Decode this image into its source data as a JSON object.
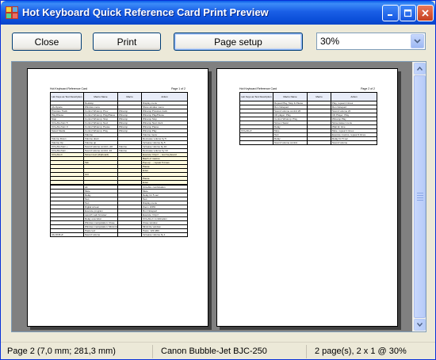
{
  "window": {
    "title": "Hot Keyboard Quick Reference Card Print Preview"
  },
  "toolbar": {
    "close_label": "Close",
    "print_label": "Print",
    "page_setup_label": "Page setup",
    "zoom_value": "30%"
  },
  "pages": [
    {
      "header_left": "Hot Keyboard Reference Card",
      "header_right": "Page 1 of 2",
      "columns": [
        "Hot Keys as Text Description",
        "Macro Name",
        "Macro",
        "Action"
      ],
      "rows": [
        [
          "",
          "Desktop",
          "",
          "Display menu"
        ],
        [
          "Alt+Space",
          "Window menu",
          "",
          "Show window menu"
        ],
        [
          "Previous Track",
          "Control Winamp: Prev",
          "Winamp",
          "Winamp Previous track"
        ],
        [
          "Play/Pause",
          "Control Winamp: Play/Pause",
          "Winamp",
          "Winamp Play/Pause"
        ],
        [
          "Stop",
          "Control Winamp: Stop",
          "Winamp",
          "Winamp Stop"
        ],
        [
          "Ctrl+Alt+Num 5",
          "Control Winamp: Next",
          "Winamp",
          "Winamp Next track"
        ],
        [
          "Ctrl+Alt+Num 0",
          "Control Winamp: Pause",
          "Winamp",
          "Winamp Pause"
        ],
        [
          "Select Media",
          "Control Winamp: Play",
          "Winamp",
          "Winamp Play"
        ],
        [
          "",
          "Volume",
          "",
          "Volume menu"
        ],
        [
          "Volume Down",
          "Volume down",
          "",
          "Decrease volume by 5"
        ],
        [
          "Volume Up",
          "Volume up",
          "",
          "Increase volume by 5"
        ],
        [
          "Ctrl+Alt+Num +",
          "Sound volume control +10",
          "Volume",
          "Increase volume by 10"
        ],
        [
          "Ctrl+Alt+Num -",
          "Sound volume control -10",
          "Volume",
          "Decrease volume by 10"
        ],
        [
          "Ctrl+Alt+C",
          "Screen text (clipboard)",
          "",
          "Execute: http://...; Hot Keyboard"
        ],
        [
          "",
          "",
          "",
          "Batch of macros"
        ],
        [
          "",
          "Tab",
          "",
          "Pop-up ...; repeat 5 times"
        ],
        [
          "",
          "",
          "",
          "Pause"
        ],
        [
          "",
          "",
          "",
          "Enter"
        ],
        [
          "",
          "Ctrl",
          "",
          ""
        ],
        [
          "",
          "",
          "",
          "Pause"
        ],
        [
          "",
          "",
          "",
          "Enter"
        ],
        [
          "",
          "",
          "",
          ""
        ],
        [
          "",
          "Alt",
          "",
          "Ctrl+Alt+ combination"
        ],
        [
          "",
          "Mute",
          "",
          "Mute"
        ],
        [
          "",
          "Delay",
          "",
          "Delay for 5 sec"
        ],
        [
          "",
          "Text",
          "",
          "Text"
        ],
        [
          "",
          "Text",
          "",
          "Display menu"
        ],
        [
          "",
          "Digital screen",
          "",
          "Zoom 100%"
        ],
        [
          "",
          "Execute program",
          "",
          "Run Notepad"
        ],
        [
          "",
          "Launch web browser",
          "",
          "Execute: http://..."
        ],
        [
          "",
          "Delay execution",
          "",
          "Ctrl+Alt+C combination"
        ],
        [
          "",
          "Window manipulation: Close",
          "",
          "Close window"
        ],
        [
          "",
          "Window manipulation: Minimize",
          "",
          "Minimize window"
        ],
        [
          "",
          "Paste text",
          "",
          "Paste: 123 ABC"
        ],
        [
          "Alt+Shift+F",
          "Sound volume",
          "",
          "Increase volume by 1"
        ]
      ]
    },
    {
      "header_left": "Hot Keyboard Reference Card",
      "header_right": "Page 2 of 2",
      "columns": [
        "Hot Keys as Text Description",
        "Macro Name",
        "Macro",
        "Action"
      ],
      "rows": [
        [
          "",
          "Repeat Play, Stop & Pause",
          "",
          "Play, repeat 2 times"
        ],
        [
          "",
          "Run Notepad",
          "",
          "Run Notepad"
        ],
        [
          "",
          "Sound volume control 20",
          "",
          "Sound volume 20"
        ],
        [
          "",
          "CD player: Play",
          "",
          "CD Player: Play"
        ],
        [
          "",
          "Control Winamp: Play",
          "",
          "Winamp Play"
        ],
        [
          "",
          "Screen Saver",
          "",
          "Screensaver menu"
        ],
        [
          "",
          "Delay",
          "",
          "Wait for time"
        ],
        [
          "Ctrl+Alt+Z",
          "Mute",
          "",
          "Mute, repeat 2 times"
        ],
        [
          "",
          "Text",
          "",
          "Execute macros, repeat 3 times"
        ],
        [
          "",
          "Delay",
          "",
          "Delay for 5 sec"
        ],
        [
          "",
          "Sound volume control",
          "",
          "Sound volume"
        ]
      ]
    }
  ],
  "statusbar": {
    "position": "Page 2 (7,0 mm; 281,3 mm)",
    "printer": "Canon Bubble-Jet BJC-250",
    "pages_info": "2 page(s), 2 x 1 @ 30%"
  },
  "colors": {
    "titlebar": "#0b4fd9",
    "preview_background": "#808080",
    "table_header": "#e8ecf8",
    "row_highlight": "#fffbe0"
  },
  "icons": {
    "app": "keyboard-app-icon",
    "minimize": "minimize-icon",
    "maximize": "maximize-icon",
    "close": "close-icon",
    "dropdown": "chevron-down-icon"
  }
}
